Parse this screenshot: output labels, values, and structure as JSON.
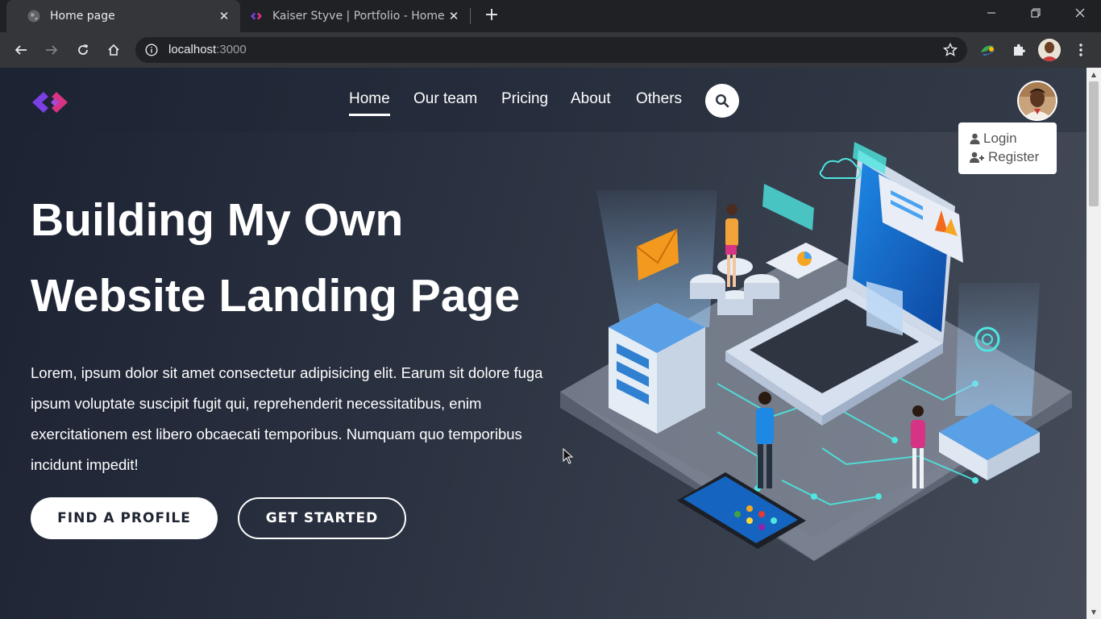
{
  "browser": {
    "tabs": [
      {
        "title": "Home page",
        "active": true
      },
      {
        "title": "Kaiser Styve | Portfolio - Home",
        "active": false
      }
    ],
    "address": {
      "host": "localhost",
      "port": ":3000"
    }
  },
  "colors": {
    "page_bg": "#2a3140",
    "accent_purple": "#7b3fe4",
    "accent_pink": "#d63384",
    "white": "#ffffff"
  },
  "nav": {
    "items": [
      "Home",
      "Our team",
      "Pricing",
      "About",
      "Others"
    ],
    "active": "Home"
  },
  "user_menu": {
    "login": "Login",
    "register": "Register"
  },
  "hero": {
    "title_line1": "Building My Own",
    "title_line2": "Website Landing Page",
    "body": "Lorem, ipsum dolor sit amet consectetur adipisicing elit. Earum sit dolore fuga ipsum voluptate suscipit fugit qui, reprehenderit necessitatibus, enim exercitationem est libero obcaecati temporibus. Numquam quo temporibus incidunt impedit!",
    "primary_button": "FIND A PROFILE",
    "secondary_button": "GET STARTED"
  },
  "icons": [
    "globe-icon",
    "logo-icon",
    "close-icon",
    "plus-icon",
    "minimize-icon",
    "maximize-icon",
    "back-icon",
    "forward-icon",
    "reload-icon",
    "home-icon",
    "info-icon",
    "star-icon",
    "extension-icon",
    "puzzle-icon",
    "menu-icon",
    "search-icon",
    "user-icon",
    "user-plus-icon"
  ]
}
